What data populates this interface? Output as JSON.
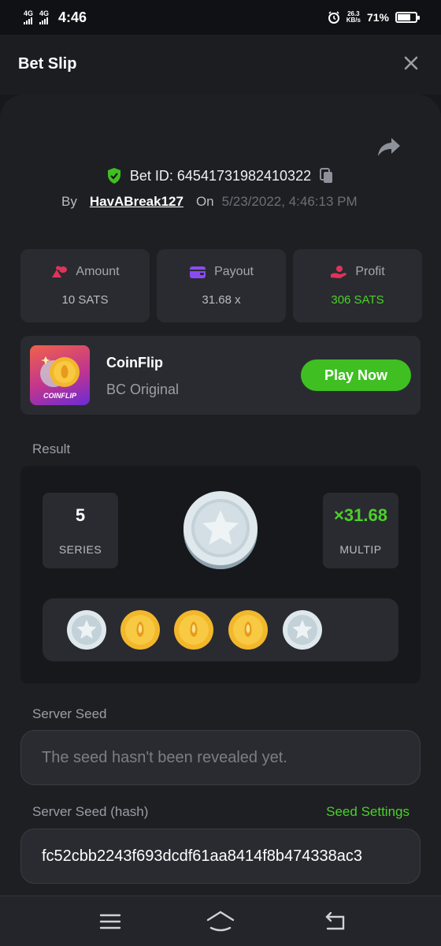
{
  "status_bar": {
    "network_1": "4G",
    "network_2": "4G",
    "time": "4:46",
    "speed_value": "26.3",
    "speed_unit": "KB/s",
    "battery": "71%"
  },
  "header": {
    "title": "Bet Slip"
  },
  "bet": {
    "id_label": "Bet ID: 64541731982410322",
    "by_label": "By",
    "user": "HavABreak127",
    "on_label": "On",
    "date": "5/23/2022, 4:46:13 PM"
  },
  "stats": [
    {
      "label": "Amount",
      "value": "10 SATS",
      "icon": "coins-icon"
    },
    {
      "label": "Payout",
      "value": "31.68 x",
      "icon": "wallet-icon"
    },
    {
      "label": "Profit",
      "value": "306 SATS",
      "icon": "hand-coin-icon"
    }
  ],
  "game": {
    "thumb_label": "COINFLIP",
    "name": "CoinFlip",
    "subtitle": "BC Original",
    "play_label": "Play Now"
  },
  "result": {
    "section_label": "Result",
    "series_value": "5",
    "series_label": "SERIES",
    "multiplier_value": "×31.68",
    "multiplier_label": "MULTIP",
    "coins": [
      "silver",
      "gold",
      "gold",
      "gold",
      "silver"
    ]
  },
  "server_seed": {
    "label": "Server Seed",
    "value": "The seed hasn't been revealed yet."
  },
  "server_seed_hash": {
    "label": "Server Seed (hash)",
    "settings_label": "Seed Settings",
    "value": "fc52cbb2243f693dcdf61aa8414f8b474338ac3"
  },
  "colors": {
    "accent_green": "#4bd12a",
    "button_green": "#3fbf22",
    "background": "#17181b",
    "card": "#2a2b30"
  }
}
